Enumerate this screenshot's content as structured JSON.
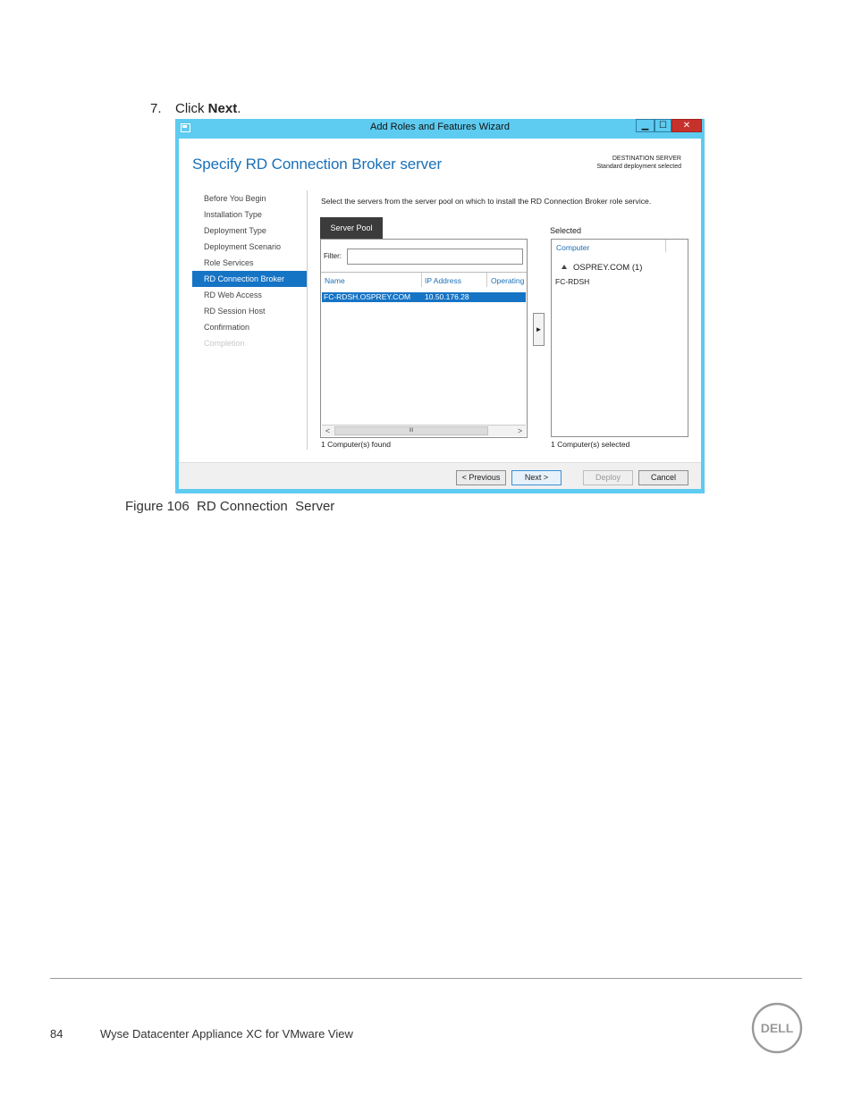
{
  "step": {
    "number": "7.",
    "text_before": "Click",
    "bold": "Next",
    "text_after": "."
  },
  "window": {
    "title": "Add Roles and Features Wizard",
    "controls": {
      "minimize": "▁",
      "maximize": "☐",
      "close": "✕"
    },
    "heading": "Specify RD Connection Broker server",
    "destination_label": "DESTINATION SERVER",
    "destination_value": "Standard deployment selected",
    "nav": [
      {
        "label": "Before You Begin",
        "state": "normal"
      },
      {
        "label": "Installation Type",
        "state": "normal"
      },
      {
        "label": "Deployment Type",
        "state": "normal"
      },
      {
        "label": "Deployment Scenario",
        "state": "normal"
      },
      {
        "label": "Role Services",
        "state": "normal"
      },
      {
        "label": "RD Connection Broker",
        "state": "active"
      },
      {
        "label": "RD Web Access",
        "state": "normal"
      },
      {
        "label": "RD Session Host",
        "state": "normal"
      },
      {
        "label": "Confirmation",
        "state": "normal"
      },
      {
        "label": "Completion",
        "state": "disabled"
      }
    ],
    "description": "Select the servers from the server pool on which to install the RD Connection Broker role service.",
    "server_pool": {
      "tab_label": "Server Pool",
      "filter_label": "Filter:",
      "filter_value": "",
      "columns": [
        "Name",
        "IP Address",
        "Operating"
      ],
      "rows": [
        {
          "name": "FC-RDSH.OSPREY.COM",
          "ip": "10.50.176.28",
          "os": ""
        }
      ],
      "scroll_left": "<",
      "scroll_thumb": "III",
      "scroll_right": ">",
      "found_text": "1 Computer(s) found"
    },
    "add_arrow": "►",
    "selected": {
      "label": "Selected",
      "column": "Computer",
      "group": "OSPREY.COM (1)",
      "members": [
        "FC-RDSH"
      ],
      "count_text": "1 Computer(s) selected"
    },
    "buttons": {
      "previous": "< Previous",
      "next": "Next >",
      "deploy": "Deploy",
      "cancel": "Cancel"
    }
  },
  "colors": {
    "title_bar": "#5ecbf0",
    "accent": "#1674c5",
    "heading": "#1a70b8"
  },
  "caption": "Figure 106  RD Connection  Server",
  "footer": {
    "page_number": "84",
    "doc_title": "Wyse Datacenter Appliance XC for VMware View",
    "logo_text": "DELL"
  }
}
